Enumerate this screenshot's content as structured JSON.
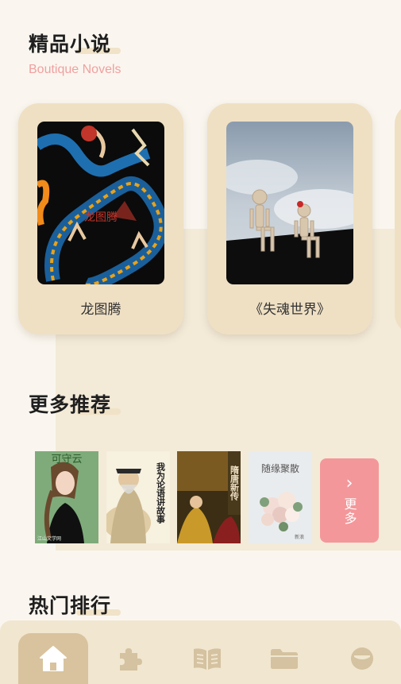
{
  "boutique": {
    "title": "精品小说",
    "subtitle": "Boutique Novels"
  },
  "novels": [
    {
      "name": "龙图腾",
      "cover_text": "龙图腾"
    },
    {
      "name": "《失魂世界》"
    }
  ],
  "recommend": {
    "title": "更多推荐",
    "books": [
      {
        "title": "可守云",
        "footer": "江山文学网"
      },
      {
        "title": "我为论语讲故事"
      },
      {
        "title": "隋唐新传"
      },
      {
        "title": "随缘聚散",
        "footer": "新浪"
      }
    ],
    "more_label": "更多"
  },
  "ranking": {
    "title": "热门排行"
  },
  "tabbar": {
    "tabs": [
      {
        "icon": "home-icon",
        "active": true
      },
      {
        "icon": "puzzle-icon"
      },
      {
        "icon": "open-book-icon"
      },
      {
        "icon": "folder-icon"
      },
      {
        "icon": "profile-icon"
      }
    ]
  },
  "colors": {
    "accent": "#f4979a",
    "card": "#efe0c4",
    "active_tab": "#d8c39e"
  }
}
